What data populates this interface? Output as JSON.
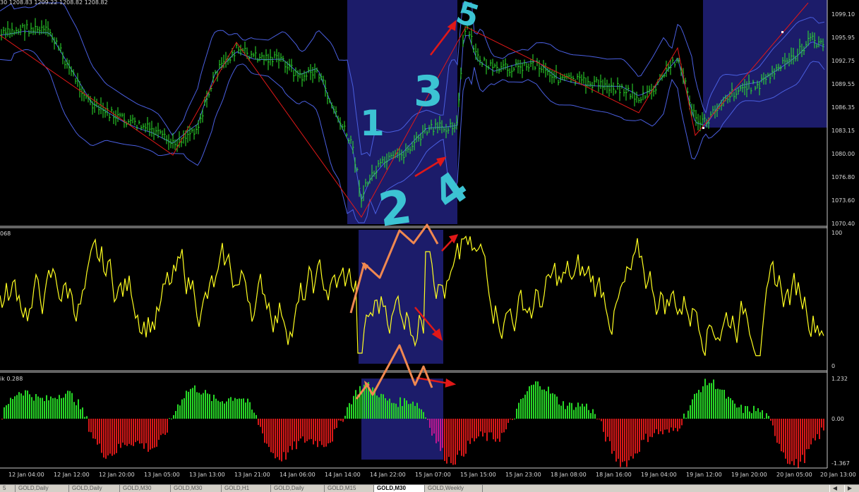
{
  "main_panel": {
    "header": "30  1208.83 1209.22 1208.82 1208.82",
    "price_labels": [
      "1099.10",
      "1095.95",
      "1092.75",
      "1089.55",
      "1086.35",
      "1083.15",
      "1080.00",
      "1076.80",
      "1073.60",
      "1070.40"
    ]
  },
  "oscillator_panel": {
    "header": "068",
    "scale_top": "100",
    "scale_bottom": "0"
  },
  "histogram_panel": {
    "header": "ik 0.288",
    "scale_top": "1.232",
    "scale_mid": "0.00",
    "scale_bottom": "-1.367"
  },
  "time_labels": [
    "12 Jan 04:00",
    "12 Jan 12:00",
    "12 Jan 20:00",
    "13 Jan 05:00",
    "13 Jan 13:00",
    "13 Jan 21:00",
    "14 Jan 06:00",
    "14 Jan 14:00",
    "14 Jan 22:00",
    "15 Jan 07:00",
    "15 Jan 15:00",
    "15 Jan 23:00",
    "18 Jan 08:00",
    "18 Jan 16:00",
    "19 Jan 04:00",
    "19 Jan 12:00",
    "19 Jan 20:00",
    "20 Jan 05:00",
    "20 Jan 13:00"
  ],
  "annotations": [
    "1",
    "2",
    "3",
    "4",
    "5"
  ],
  "tabs": [
    {
      "label": "5",
      "active": false
    },
    {
      "label": "GOLD,Daily",
      "active": false
    },
    {
      "label": "GOLD,Daily",
      "active": false
    },
    {
      "label": "GOLD,M30",
      "active": false
    },
    {
      "label": "GOLD,M30",
      "active": false
    },
    {
      "label": "GOLD,H1",
      "active": false
    },
    {
      "label": "GOLD,Daily",
      "active": false
    },
    {
      "label": "GOLD,M15",
      "active": false
    },
    {
      "label": "GOLD,M30",
      "active": true
    },
    {
      "label": "GOLD,Weekly",
      "active": false
    }
  ],
  "tab_nav": {
    "left": "◀",
    "right": "▶"
  },
  "colors": {
    "background": "#000000",
    "candles": "#2ee82e",
    "bands": "#4a5fe0",
    "zigzag": "#e01818",
    "highlight": "#1c1c6a",
    "oscillator": "#ffff20",
    "hist_up": "#27d827",
    "hist_down": "#d81818",
    "hist_magenta": "#c01890",
    "annotation": "#3cc3d3",
    "orange_arrow": "#f08850"
  }
}
